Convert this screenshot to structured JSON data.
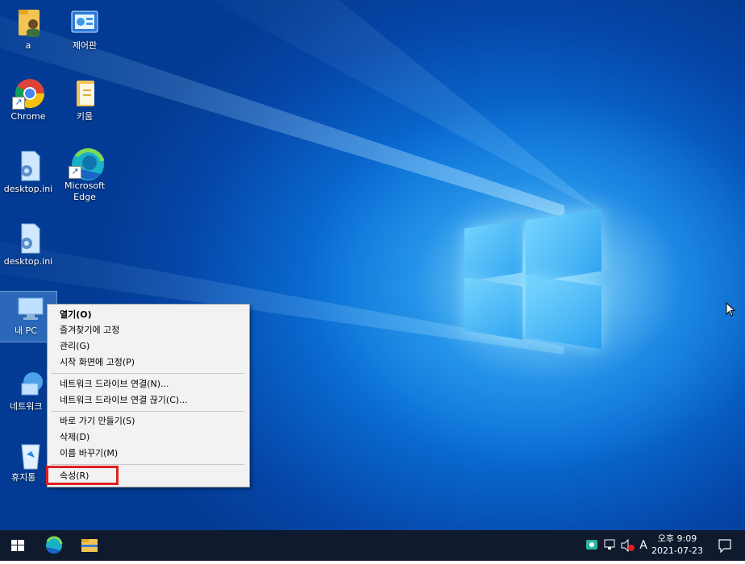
{
  "desktop": {
    "icons": [
      {
        "label": "a",
        "icon": "user-folder-icon"
      },
      {
        "label": "제어판",
        "icon": "control-panel-icon"
      },
      {
        "label": "Chrome",
        "icon": "chrome-icon"
      },
      {
        "label": "키움",
        "icon": "folder-icon"
      },
      {
        "label": "desktop.ini",
        "icon": "settings-file-icon"
      },
      {
        "label": "Microsoft Edge",
        "icon": "edge-icon"
      },
      {
        "label": "desktop.ini",
        "icon": "settings-file-icon"
      },
      {
        "label": "내 PC",
        "icon": "this-pc-icon"
      },
      {
        "label": "네트워크",
        "icon": "network-icon"
      },
      {
        "label": "휴지통",
        "icon": "recycle-bin-icon"
      }
    ]
  },
  "context_menu": {
    "items": [
      {
        "label": "열기(O)",
        "bold": true
      },
      {
        "label": "즐겨찾기에 고정"
      },
      {
        "label": "관리(G)"
      },
      {
        "label": "시작 화면에 고정(P)"
      },
      {
        "label": "네트워크 드라이브 연결(N)..."
      },
      {
        "label": "네트워크 드라이브 연결 끊기(C)..."
      },
      {
        "label": "바로 가기 만들기(S)"
      },
      {
        "label": "삭제(D)"
      },
      {
        "label": "이름 바꾸기(M)"
      },
      {
        "label": "속성(R)"
      }
    ]
  },
  "taskbar": {
    "buttons": [
      "start-icon",
      "edge-icon",
      "file-explorer-icon"
    ],
    "tray": {
      "input_indicator": "A",
      "time": "오후 9:09",
      "date": "2021-07-23"
    }
  },
  "colors": {
    "highlight": "#e02020",
    "taskbar": "#0f1a2e"
  }
}
